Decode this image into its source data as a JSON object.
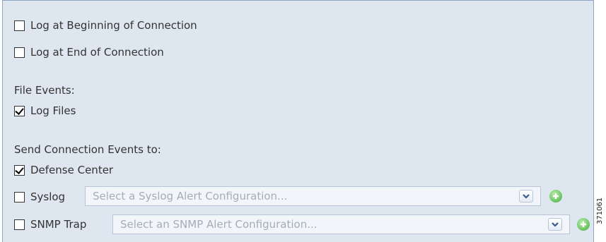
{
  "connection_logging": {
    "log_beginning": {
      "label": "Log at Beginning of Connection",
      "checked": false
    },
    "log_end": {
      "label": "Log at End of Connection",
      "checked": false
    }
  },
  "file_events": {
    "heading": "File Events:",
    "log_files": {
      "label": "Log Files",
      "checked": true
    }
  },
  "send_events": {
    "heading": "Send Connection Events to:",
    "defense_center": {
      "label": "Defense Center",
      "checked": true
    },
    "syslog": {
      "label": "Syslog",
      "checked": false,
      "placeholder": "Select a Syslog Alert Configuration..."
    },
    "snmp_trap": {
      "label": "SNMP Trap",
      "checked": false,
      "placeholder": "Select an SNMP Alert Configuration..."
    }
  },
  "figure_id": "371061",
  "colors": {
    "panel_bg": "#dee6f0",
    "panel_border": "#8fa4c4",
    "add_icon": "#66c15b"
  }
}
